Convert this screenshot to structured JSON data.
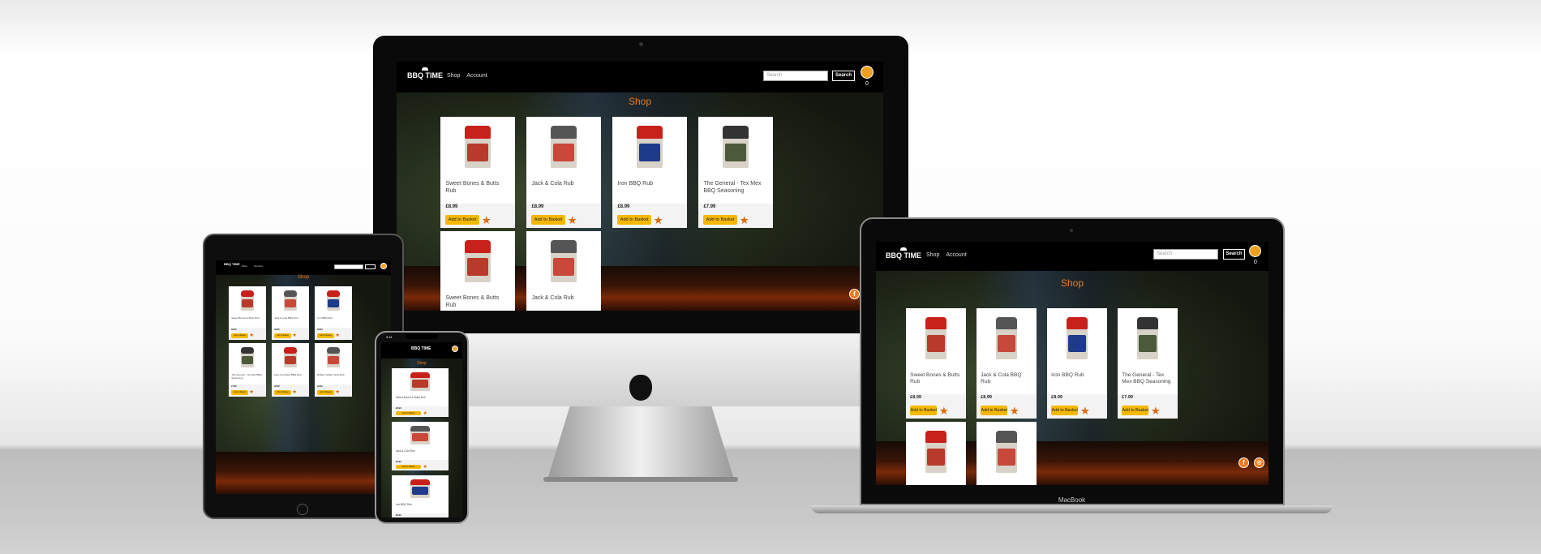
{
  "site": {
    "logo_text": "BBQ TIME",
    "nav": {
      "shop": "Shop",
      "account": "Account"
    },
    "search": {
      "placeholder": "Search",
      "button": "Search"
    },
    "basket_count": "0",
    "shop_title": "Shop",
    "products": [
      {
        "name": "Sweet Bones & Butts Rub",
        "price": "£8.99",
        "lid_color": "#c8201a",
        "label_color": "#b83a2a"
      },
      {
        "name": "Jack & Cola Rub",
        "price": "£8.99",
        "lid_color": "#555555",
        "label_color": "#c8483a"
      },
      {
        "name": "Iron BBQ Rub",
        "price": "£8.99",
        "lid_color": "#c8201a",
        "label_color": "#1e3a8a"
      },
      {
        "name": "The General - Tex Mex BBQ Seasoning",
        "price": "£7.99",
        "lid_color": "#333333",
        "label_color": "#4a5a3a"
      }
    ],
    "products_laptop": [
      {
        "name": "Sweet Bones & Butts Rub"
      },
      {
        "name": "Jack & Cola BBQ Rub"
      },
      {
        "name": "Iron BBQ Rub"
      },
      {
        "name": "The General - Tex Mex BBQ Seasoning"
      }
    ],
    "products_tablet": [
      {
        "name": "Sweet Bones & Butts Rub"
      },
      {
        "name": "Jack & Cola BBQ Rub"
      },
      {
        "name": "Iron BBQ Rub"
      },
      {
        "name": "The General - Tex Mex BBQ Seasoning"
      },
      {
        "name": "Holy Cow Beef BBQ Rub"
      },
      {
        "name": "Buffalo Soldier Wing Rub"
      }
    ],
    "add_to_basket": "Add to Basket",
    "accent_color": "#f07a1a",
    "button_color": "#f5b800"
  },
  "laptop_brand": "MacBook",
  "phone_time": "9:41"
}
